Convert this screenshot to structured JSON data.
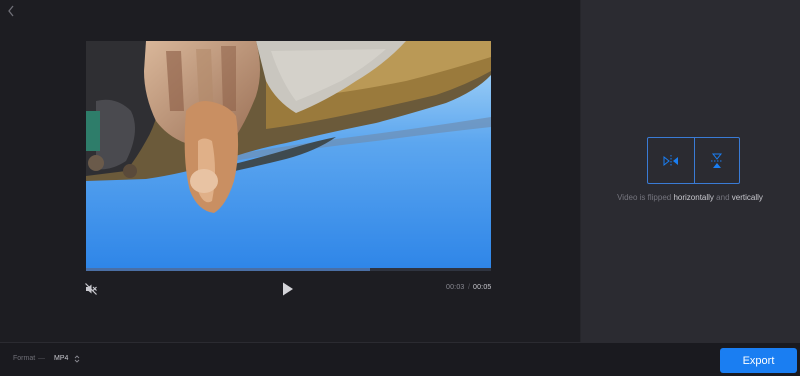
{
  "player": {
    "current_time": "00:03",
    "separator": "/",
    "duration": "00:05",
    "progress": 0.7,
    "muted": true
  },
  "flip": {
    "status_prefix": "Video is flipped",
    "horizontal_word": "horizontally",
    "conjunction": "and",
    "vertical_word": "vertically",
    "horizontal_active": true,
    "vertical_active": true
  },
  "format": {
    "label": "Format",
    "dash": "—",
    "value": "MP4"
  },
  "export": {
    "label": "Export"
  },
  "colors": {
    "accent": "#1a7ef2",
    "outline": "#3a7bd5",
    "background": "#1d1d22",
    "panel": "#2b2b31"
  },
  "icons": [
    "back-chevron-icon",
    "mute-icon",
    "play-icon",
    "flip-horizontal-icon",
    "flip-vertical-icon",
    "select-chevrons-icon"
  ]
}
